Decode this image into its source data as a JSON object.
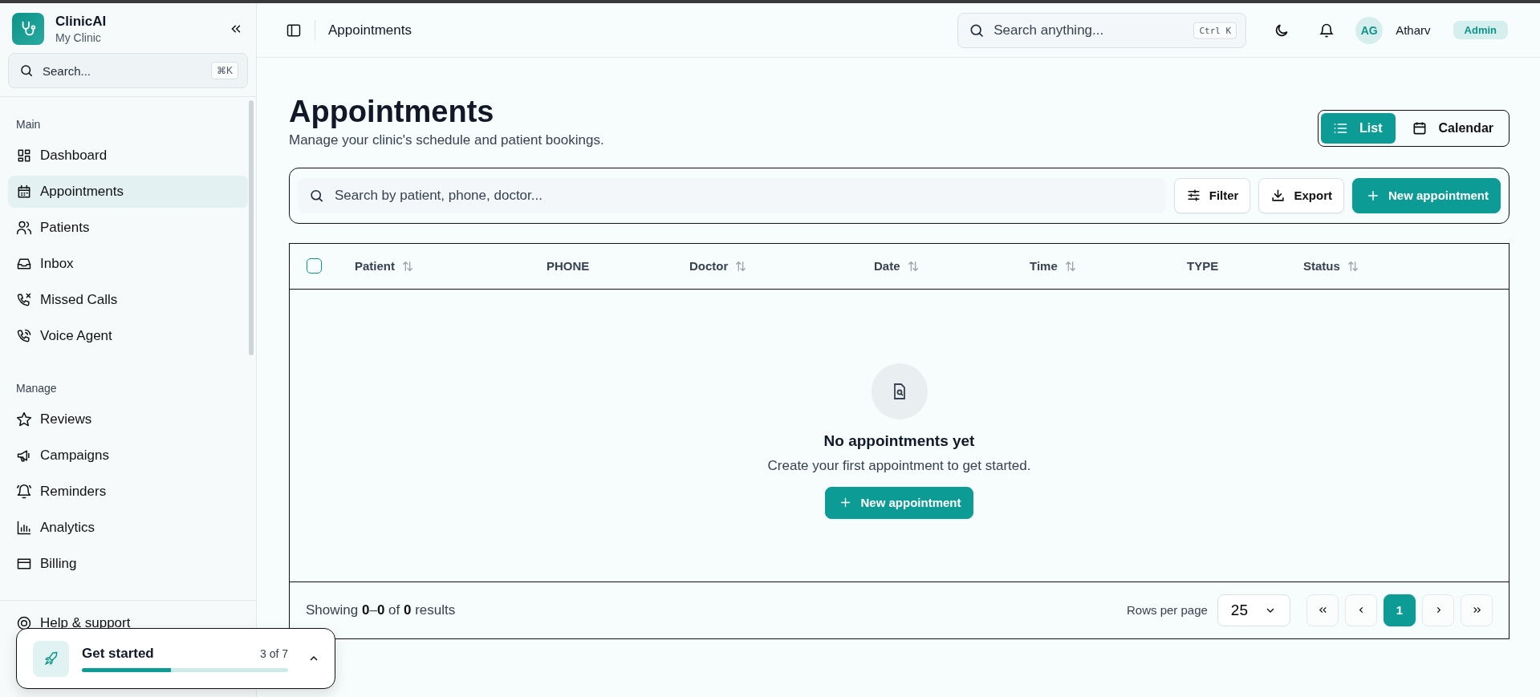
{
  "sidebar": {
    "brand": {
      "name": "ClinicAI",
      "subtitle": "My Clinic"
    },
    "search": {
      "placeholder": "Search...",
      "shortcut": "⌘K"
    },
    "sections": [
      {
        "title": "Main",
        "items": [
          {
            "label": "Dashboard",
            "selected": false
          },
          {
            "label": "Appointments",
            "selected": true
          },
          {
            "label": "Patients",
            "selected": false
          },
          {
            "label": "Inbox",
            "selected": false
          },
          {
            "label": "Missed Calls",
            "selected": false
          },
          {
            "label": "Voice Agent",
            "selected": false
          }
        ]
      },
      {
        "title": "Manage",
        "items": [
          {
            "label": "Reviews",
            "selected": false
          },
          {
            "label": "Campaigns",
            "selected": false
          },
          {
            "label": "Reminders",
            "selected": false
          },
          {
            "label": "Analytics",
            "selected": false
          },
          {
            "label": "Billing",
            "selected": false
          }
        ]
      }
    ],
    "help": {
      "label": "Help & support"
    }
  },
  "header": {
    "title": "Appointments",
    "search": {
      "placeholder": "Search anything...",
      "shortcut": "Ctrl K"
    },
    "user": {
      "initials": "AG",
      "name": "Atharv",
      "role": "Admin"
    }
  },
  "page": {
    "title": "Appointments",
    "subtitle": "Manage your clinic's schedule and patient bookings.",
    "views": [
      {
        "label": "List",
        "selected": true
      },
      {
        "label": "Calendar",
        "selected": false
      }
    ]
  },
  "toolbar": {
    "search": {
      "placeholder": "Search by patient, phone, doctor..."
    },
    "filter": "Filter",
    "export": "Export",
    "new": "New appointment"
  },
  "table": {
    "select_all": {
      "checked": false
    },
    "columns": [
      {
        "label": "Patient",
        "sortable": true
      },
      {
        "label": "PHONE",
        "sortable": false
      },
      {
        "label": "Doctor",
        "sortable": true
      },
      {
        "label": "Date",
        "sortable": true
      },
      {
        "label": "Time",
        "sortable": true
      },
      {
        "label": "TYPE",
        "sortable": false
      },
      {
        "label": "Status",
        "sortable": true
      }
    ],
    "empty": {
      "title": "No appointments yet",
      "message": "Create your first appointment to get started.",
      "button": "New appointment"
    },
    "footer": {
      "showing": "Showing **0**–**0** of **0** results",
      "rows_label": "Rows per page",
      "rows_value": "25",
      "pages": [
        {
          "label": "1",
          "selected": true
        }
      ]
    }
  },
  "get_started": {
    "title": "Get started",
    "count": "3 of 7",
    "level": 0.43
  }
}
